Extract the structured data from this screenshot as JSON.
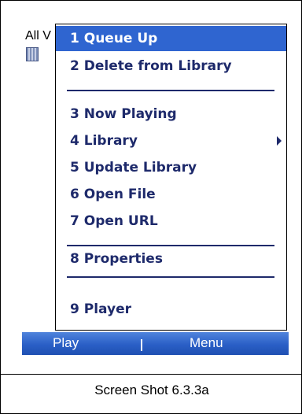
{
  "background": {
    "title": "All V"
  },
  "menu": {
    "items": [
      {
        "label": "1 Queue Up",
        "selected": true
      },
      {
        "label": "2 Delete from Library"
      },
      {
        "label": "3 Now Playing"
      },
      {
        "label": "4 Library",
        "has_submenu": true
      },
      {
        "label": "5 Update Library"
      },
      {
        "label": "6 Open File"
      },
      {
        "label": "7 Open URL"
      },
      {
        "label": "8 Properties"
      },
      {
        "label": "9 Player"
      }
    ]
  },
  "softkeys": {
    "left": "Play",
    "right": "Menu"
  },
  "caption": "Screen Shot 6.3.3a",
  "colors": {
    "menu_text": "#1e2a6b",
    "selection": "#2f65d0",
    "softkey_bar": "#2a5fc6"
  }
}
